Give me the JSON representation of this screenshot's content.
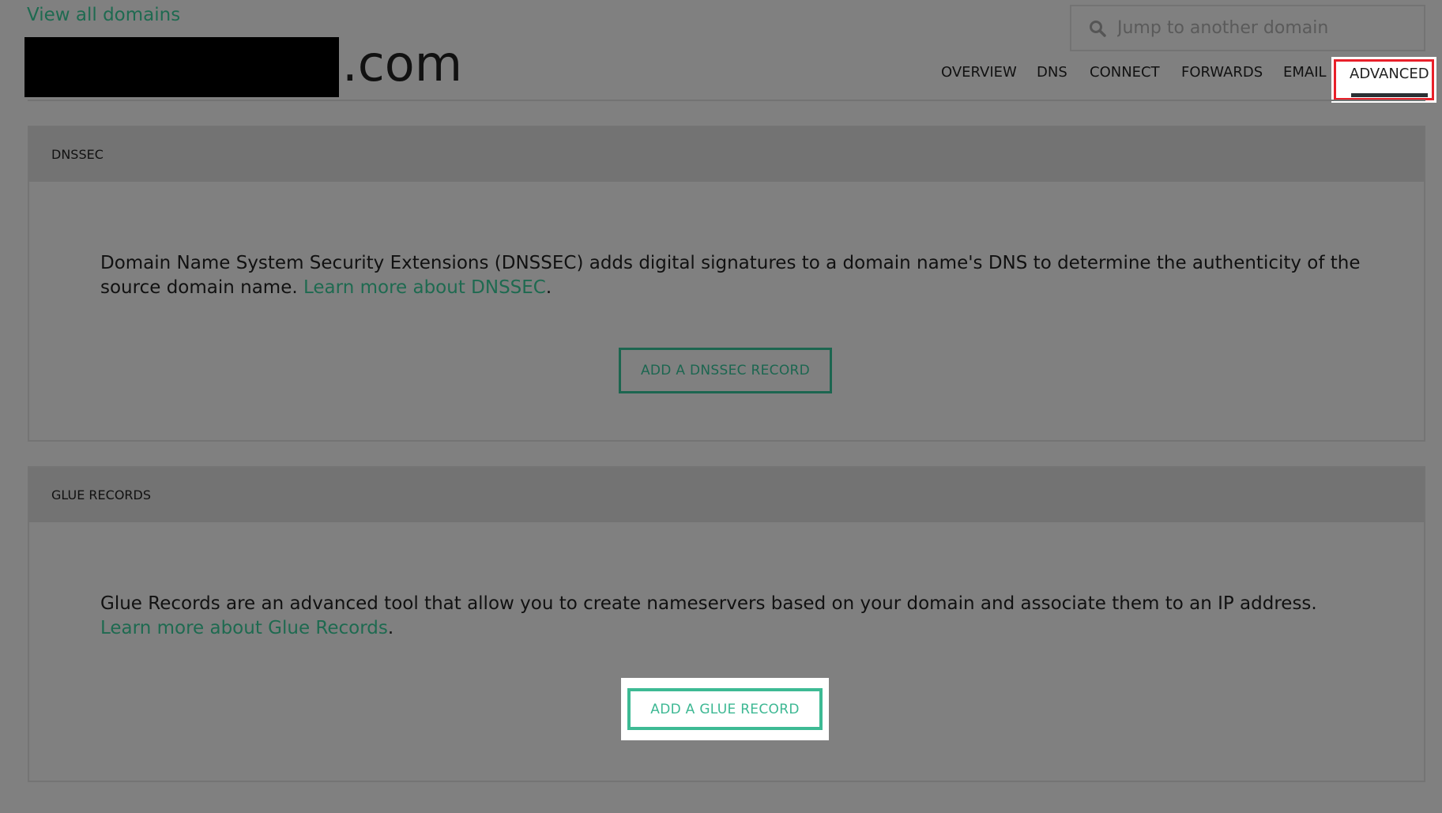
{
  "header": {
    "view_all": "View all domains",
    "domain_suffix": ".com",
    "search_placeholder": "Jump to another domain"
  },
  "tabs": [
    {
      "label": "OVERVIEW"
    },
    {
      "label": "DNS"
    },
    {
      "label": "CONNECT"
    },
    {
      "label": "FORWARDS"
    },
    {
      "label": "EMAIL"
    },
    {
      "label": "ADVANCED",
      "active": true
    }
  ],
  "dnssec": {
    "title": "DNSSEC",
    "text": "Domain Name System Security Extensions (DNSSEC) adds digital signatures to a domain name's DNS to determine the authenticity of the source domain name. ",
    "link": "Learn more about DNSSEC",
    "after": ".",
    "button": "ADD A DNSSEC RECORD"
  },
  "glue": {
    "title": "GLUE RECORDS",
    "text": "Glue Records are an advanced tool that allow you to create nameservers based on your domain and associate them to an IP address. ",
    "link": "Learn more about Glue Records",
    "after": ".",
    "button": "ADD A GLUE RECORD"
  },
  "colors": {
    "accent": "#3dba94",
    "highlight": "#e8202a",
    "background": "#808080"
  }
}
